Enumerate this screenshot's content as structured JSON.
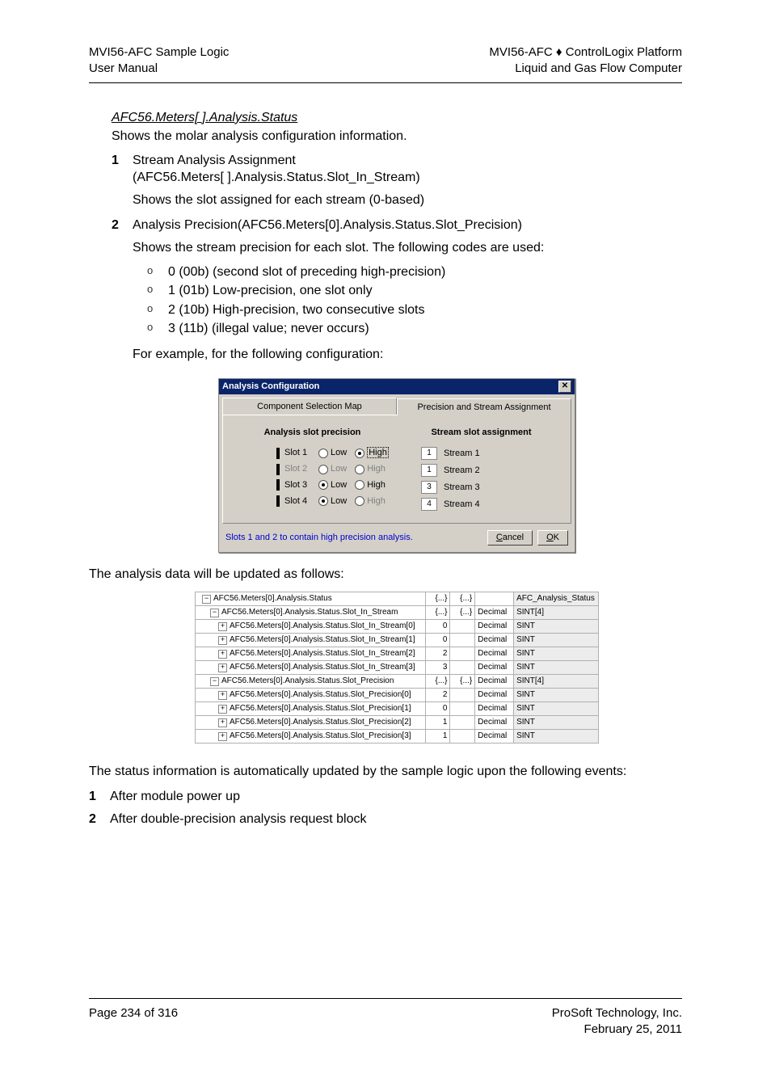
{
  "header": {
    "left1": "MVI56-AFC Sample Logic",
    "left2": "User Manual",
    "right1": "MVI56-AFC ♦ ControlLogix Platform",
    "right2": "Liquid and Gas Flow Computer"
  },
  "section_title": "AFC56.Meters[ ].Analysis.Status",
  "intro": "Shows the molar analysis configuration information.",
  "item1": {
    "num": "1",
    "line1": "Stream Analysis Assignment",
    "line2": "(AFC56.Meters[ ].Analysis.Status.Slot_In_Stream)",
    "sub": "Shows the slot assigned for each stream (0-based)"
  },
  "item2": {
    "num": "2",
    "line1": "Analysis Precision(AFC56.Meters[0].Analysis.Status.Slot_Precision)",
    "sub": "Shows the stream precision for each slot. The following codes are used:",
    "bullets": [
      "0 (00b) (second slot of preceding high-precision)",
      "1 (01b) Low-precision, one slot only",
      "2 (10b) High-precision, two consecutive slots",
      "3 (11b) (illegal value; never occurs)"
    ],
    "after": "For example, for the following configuration:"
  },
  "dialog": {
    "title": "Analysis Configuration",
    "tab1": "Component Selection Map",
    "tab2": "Precision and Stream Assignment",
    "col1_title": "Analysis slot precision",
    "col2_title": "Stream slot assignment",
    "slots": [
      {
        "label": "Slot 1",
        "low_sel": false,
        "high_sel": true,
        "disabled": false,
        "focus_high": true
      },
      {
        "label": "Slot 2",
        "low_sel": false,
        "high_sel": false,
        "disabled": true,
        "focus_high": false
      },
      {
        "label": "Slot 3",
        "low_sel": true,
        "high_sel": false,
        "disabled": false,
        "focus_high": false
      },
      {
        "label": "Slot 4",
        "low_sel": true,
        "high_sel": false,
        "disabled": false,
        "high_disabled": true,
        "focus_high": false
      }
    ],
    "low_label": "Low",
    "high_label": "High",
    "streams": [
      {
        "num": "1",
        "label": "Stream 1"
      },
      {
        "num": "1",
        "label": "Stream 2"
      },
      {
        "num": "3",
        "label": "Stream 3"
      },
      {
        "num": "4",
        "label": "Stream 4"
      }
    ],
    "hint": "Slots 1 and 2 to contain high precision analysis.",
    "cancel": "Cancel",
    "ok": "OK"
  },
  "para1": "The analysis data will be updated as follows:",
  "table": {
    "rows": [
      {
        "indent": 1,
        "toggle": "−",
        "name": "AFC56.Meters[0].Analysis.Status",
        "v1": "{...}",
        "v2": "{...}",
        "style": "",
        "type": "AFC_Analysis_Status"
      },
      {
        "indent": 2,
        "toggle": "−",
        "name": "AFC56.Meters[0].Analysis.Status.Slot_In_Stream",
        "v1": "{...}",
        "v2": "{...}",
        "style": "Decimal",
        "type": "SINT[4]"
      },
      {
        "indent": 3,
        "toggle": "+",
        "name": "AFC56.Meters[0].Analysis.Status.Slot_In_Stream[0]",
        "v1": "0",
        "v2": "",
        "style": "Decimal",
        "type": "SINT"
      },
      {
        "indent": 3,
        "toggle": "+",
        "name": "AFC56.Meters[0].Analysis.Status.Slot_In_Stream[1]",
        "v1": "0",
        "v2": "",
        "style": "Decimal",
        "type": "SINT"
      },
      {
        "indent": 3,
        "toggle": "+",
        "name": "AFC56.Meters[0].Analysis.Status.Slot_In_Stream[2]",
        "v1": "2",
        "v2": "",
        "style": "Decimal",
        "type": "SINT"
      },
      {
        "indent": 3,
        "toggle": "+",
        "name": "AFC56.Meters[0].Analysis.Status.Slot_In_Stream[3]",
        "v1": "3",
        "v2": "",
        "style": "Decimal",
        "type": "SINT"
      },
      {
        "indent": 2,
        "toggle": "−",
        "name": "AFC56.Meters[0].Analysis.Status.Slot_Precision",
        "v1": "{...}",
        "v2": "{...}",
        "style": "Decimal",
        "type": "SINT[4]"
      },
      {
        "indent": 3,
        "toggle": "+",
        "name": "AFC56.Meters[0].Analysis.Status.Slot_Precision[0]",
        "v1": "2",
        "v2": "",
        "style": "Decimal",
        "type": "SINT"
      },
      {
        "indent": 3,
        "toggle": "+",
        "name": "AFC56.Meters[0].Analysis.Status.Slot_Precision[1]",
        "v1": "0",
        "v2": "",
        "style": "Decimal",
        "type": "SINT"
      },
      {
        "indent": 3,
        "toggle": "+",
        "name": "AFC56.Meters[0].Analysis.Status.Slot_Precision[2]",
        "v1": "1",
        "v2": "",
        "style": "Decimal",
        "type": "SINT"
      },
      {
        "indent": 3,
        "toggle": "+",
        "name": "AFC56.Meters[0].Analysis.Status.Slot_Precision[3]",
        "v1": "1",
        "v2": "",
        "style": "Decimal",
        "type": "SINT"
      }
    ]
  },
  "para2": "The status information is automatically updated by the sample logic upon the following events:",
  "events": {
    "e1_num": "1",
    "e1": "After module power up",
    "e2_num": "2",
    "e2": "After double-precision analysis request block"
  },
  "footer": {
    "left": "Page 234 of 316",
    "right1": "ProSoft Technology, Inc.",
    "right2": "February 25, 2011"
  }
}
